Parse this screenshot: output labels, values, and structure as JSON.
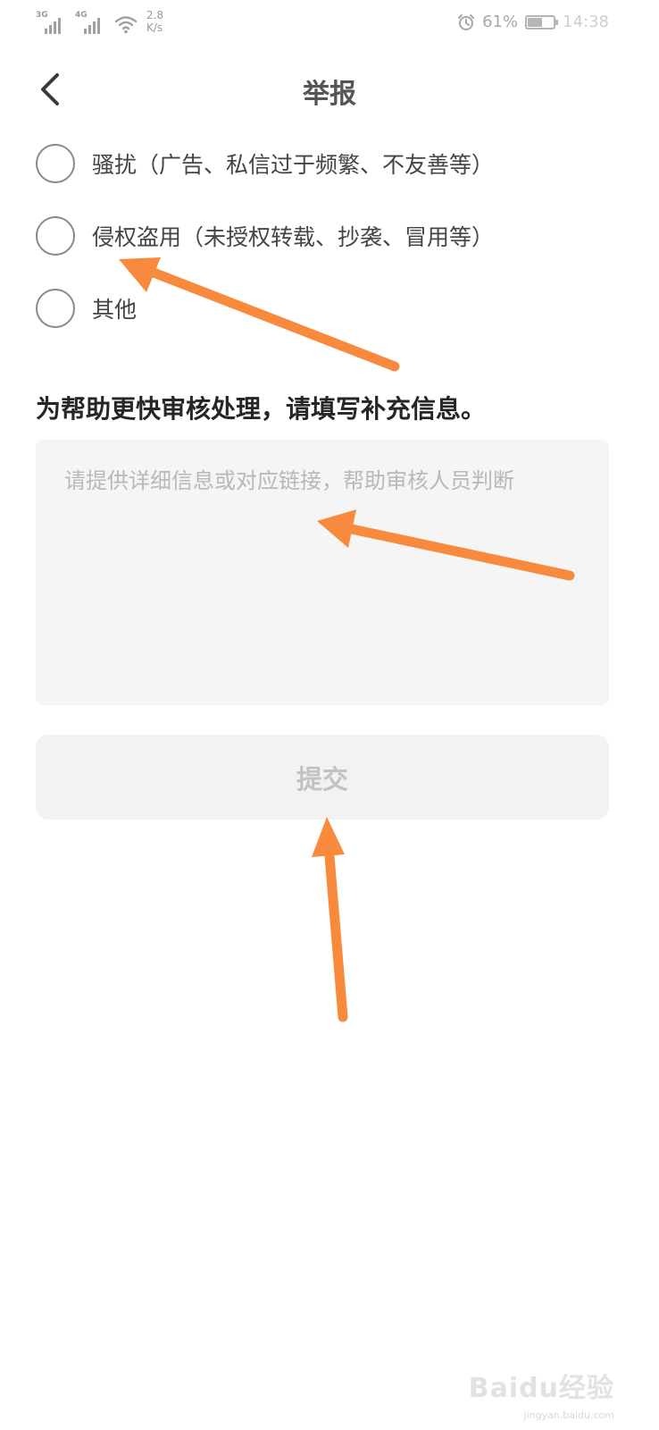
{
  "status_bar": {
    "net1": "3G",
    "net2": "4G",
    "speed_value": "2.8",
    "speed_unit": "K/s",
    "battery_percent": "61%",
    "battery_level": 0.61,
    "time": "14:38"
  },
  "header": {
    "title": "举报"
  },
  "options": [
    {
      "label": "骚扰（广告、私信过于频繁、不友善等）",
      "selected": false
    },
    {
      "label": "侵权盗用（未授权转载、抄袭、冒用等）",
      "selected": false
    },
    {
      "label": "其他",
      "selected": false
    }
  ],
  "form": {
    "hint": "为帮助更快审核处理，请填写补充信息。",
    "placeholder": "请提供详细信息或对应链接，帮助审核人员判断",
    "value": ""
  },
  "submit": {
    "label": "提交"
  },
  "watermark": {
    "main": "Baidu经验",
    "sub": "jingyan.baidu.com"
  },
  "colors": {
    "annotation_arrow": "#f78a3c",
    "submit_bg": "#f2f2f2",
    "textarea_bg": "#f5f5f5"
  },
  "icons": {
    "back": "chevron-left-icon",
    "alarm": "alarm-icon",
    "wifi": "wifi-icon",
    "battery": "battery-icon"
  }
}
